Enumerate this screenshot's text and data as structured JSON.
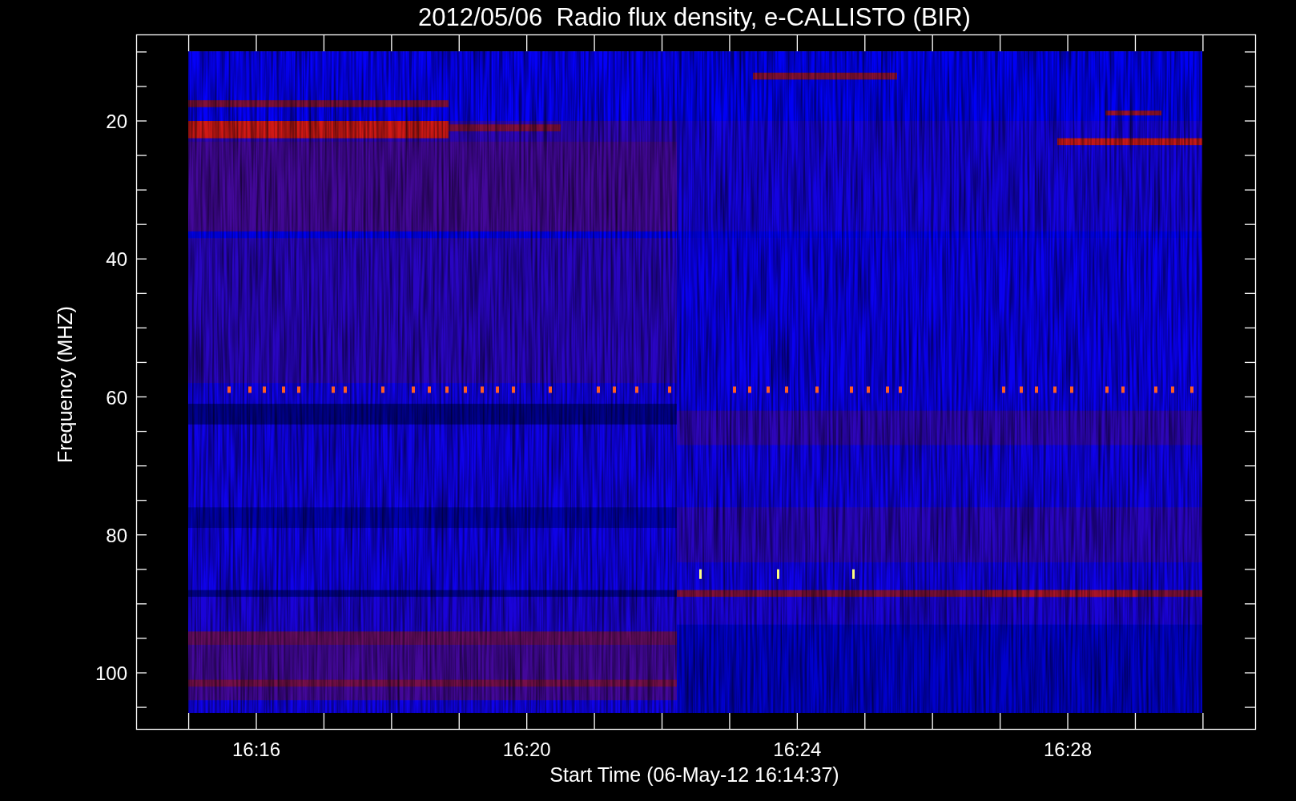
{
  "title": "2012/05/06  Radio flux density, e-CALLISTO (BIR)",
  "ylabel": "Frequency (MHZ)",
  "xlabel": "Start Time (06-May-12 16:14:37)",
  "ytick_labels": [
    "20",
    "40",
    "60",
    "80",
    "100"
  ],
  "xtick_labels": [
    "16:16",
    "16:20",
    "16:24",
    "16:28"
  ]
}
